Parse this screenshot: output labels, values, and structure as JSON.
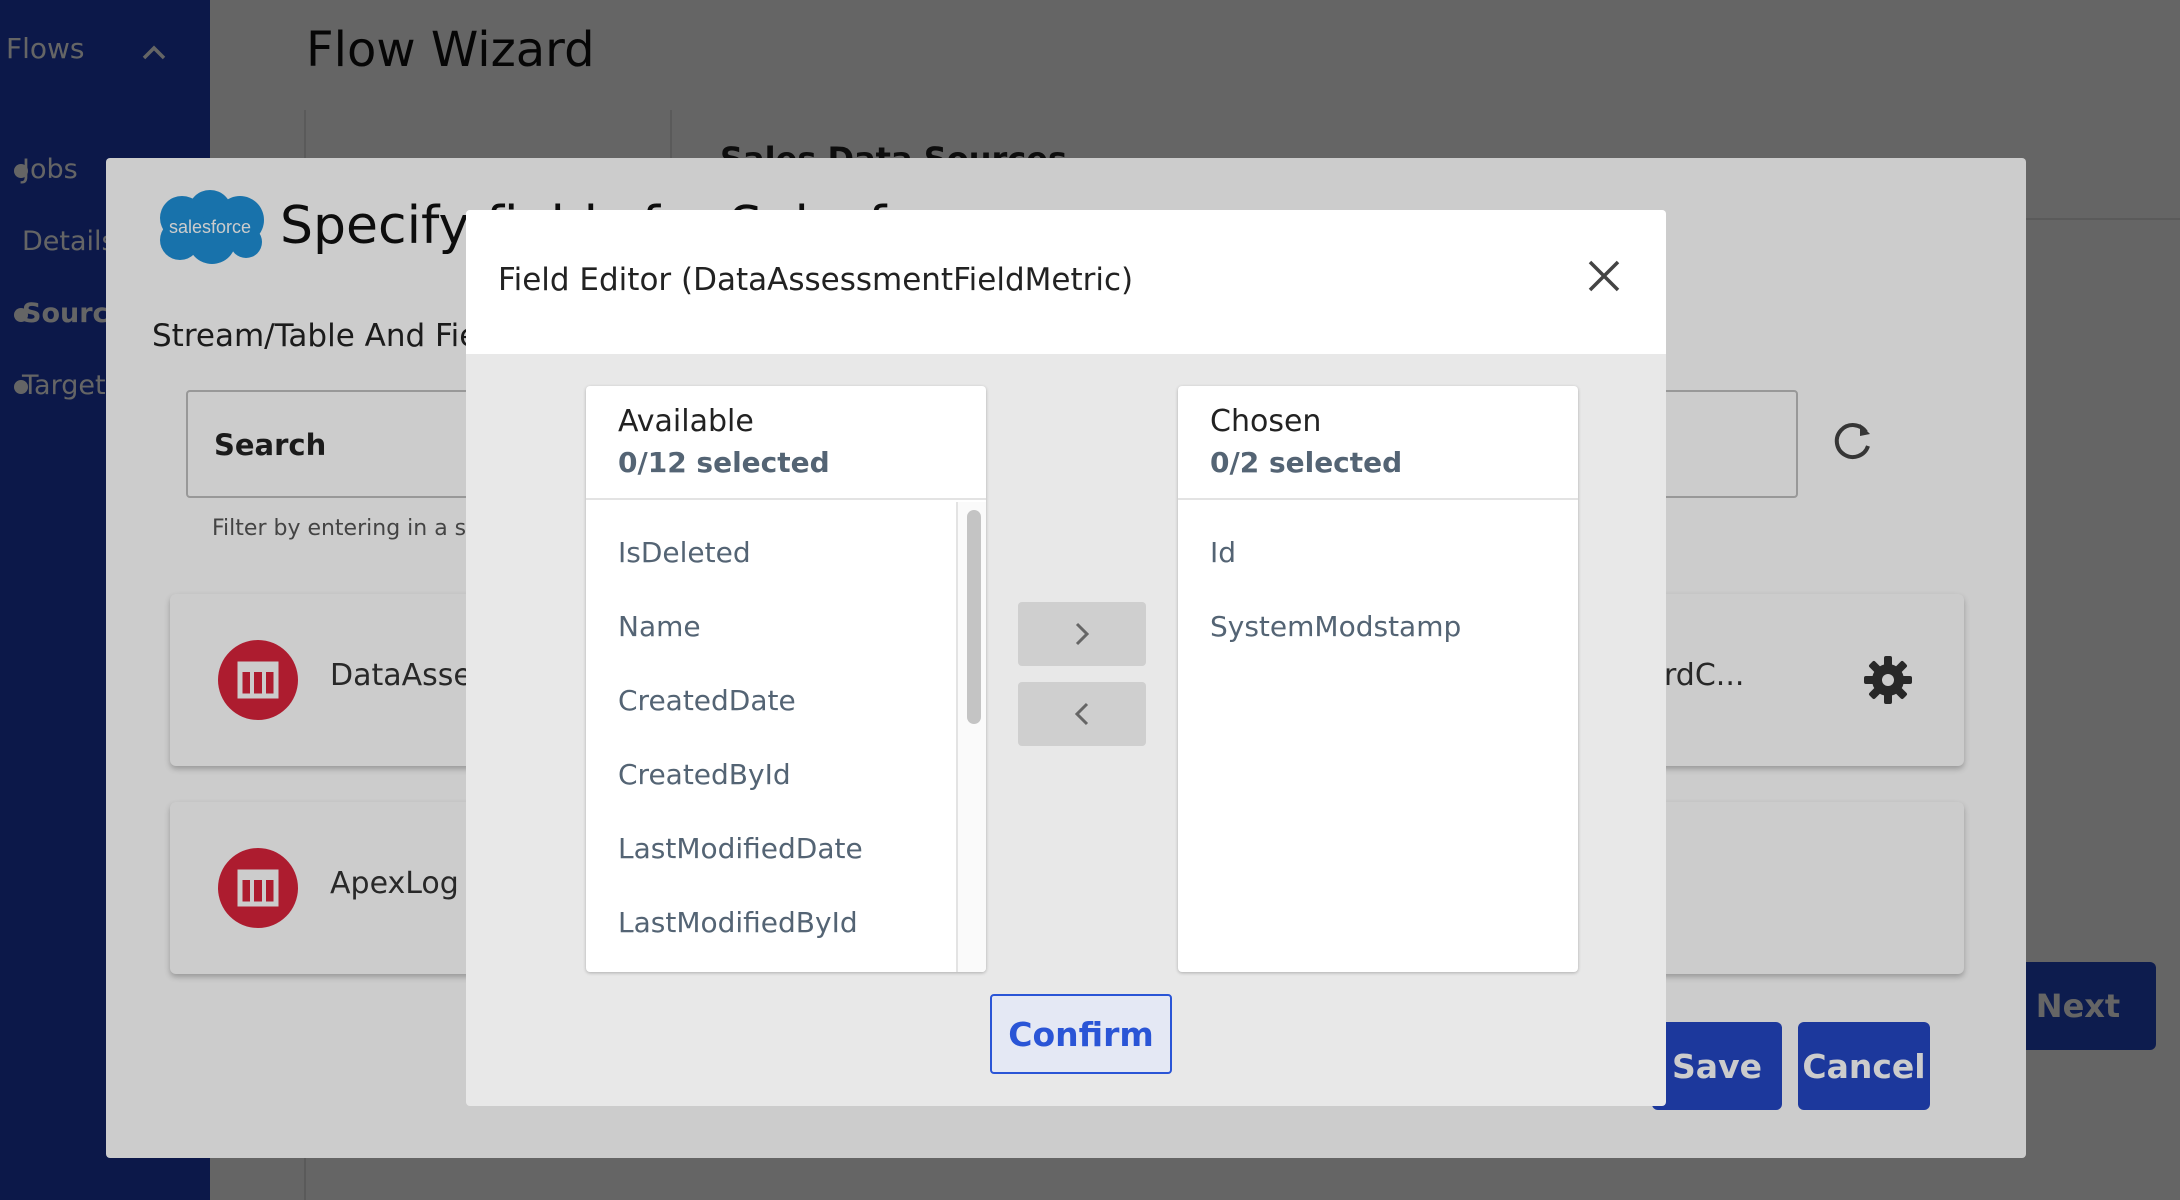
{
  "sidebar": {
    "flows_label": "Flows",
    "items": [
      {
        "label": "Jobs"
      },
      {
        "label": "Details"
      },
      {
        "label": "Sources"
      },
      {
        "label": "Targets"
      }
    ]
  },
  "app": {
    "title": "Flow Wizard",
    "section_title": "Sales Data Sources",
    "next_label": "Next"
  },
  "spec_modal": {
    "logo_text": "salesforce",
    "title": "Specify fields for Salesforce",
    "section_label": "Stream/Table And Fields",
    "search_label": "Search",
    "search_help": "Filter by entering in a string",
    "tiles": [
      {
        "name": "DataAssessmentFieldMetric",
        "right_text": "rdC..."
      },
      {
        "name": "ApexLog"
      }
    ],
    "save_label": "Save",
    "cancel_label": "Cancel"
  },
  "field_editor": {
    "title": "Field Editor (DataAssessmentFieldMetric)",
    "available": {
      "title": "Available",
      "count": "0/12 selected",
      "items": [
        "IsDeleted",
        "Name",
        "CreatedDate",
        "CreatedById",
        "LastModifiedDate",
        "LastModifiedById"
      ]
    },
    "chosen": {
      "title": "Chosen",
      "count": "0/2 selected",
      "items": [
        "Id",
        "SystemModstamp"
      ]
    },
    "confirm_label": "Confirm"
  },
  "colors": {
    "sidebar": "#1f3fb8",
    "primary_button": "#2346c4",
    "confirm_accent": "#2a55d6",
    "table_icon": "#d9233b",
    "list_text": "#546474"
  },
  "icons": [
    "chevron-up-icon",
    "salesforce-logo",
    "refresh-icon",
    "table-icon",
    "gear-icon",
    "close-icon",
    "chevron-right-icon",
    "chevron-left-icon"
  ]
}
